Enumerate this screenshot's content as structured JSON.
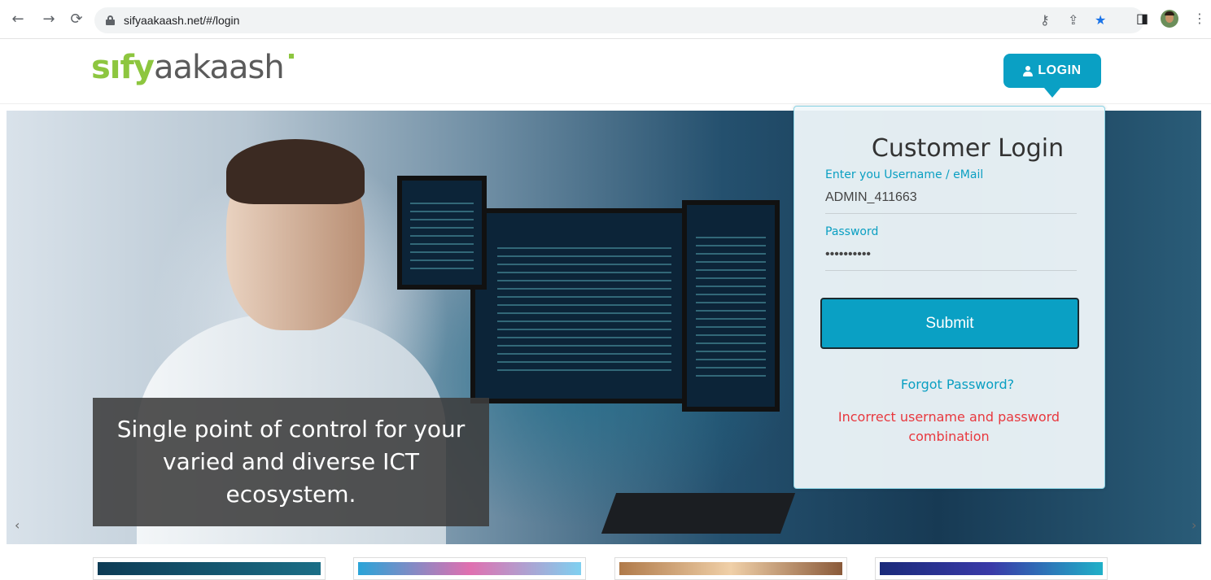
{
  "browser": {
    "url": "sifyaakaash.net/#/login",
    "back_icon": "arrow-left-icon",
    "forward_icon": "arrow-right-icon",
    "reload_icon": "reload-icon",
    "lock_icon": "lock-icon",
    "key_icon": "key-icon",
    "share_icon": "share-icon",
    "bookmark_icon": "star-icon",
    "sidepanel_icon": "side-panel-icon",
    "menu_icon": "kebab-menu-icon"
  },
  "header": {
    "logo_sify": "sıfy",
    "logo_aakaash": "aakaash",
    "login_button": "LOGIN"
  },
  "hero": {
    "caption": "Single point of control for your varied and diverse ICT ecosystem.",
    "prev_arrow": "‹",
    "next_arrow": "›"
  },
  "login_panel": {
    "title": "Customer Login",
    "username_label": "Enter you Username / eMail",
    "username_value": "ADMIN_411663",
    "password_label": "Password",
    "password_value": "••••••••••",
    "submit_label": "Submit",
    "forgot_label": "Forgot Password?",
    "error_message": "Incorrect username and password combination"
  },
  "colors": {
    "accent": "#0aa0c4",
    "logo_green": "#8dc63f",
    "error_red": "#e8383e"
  }
}
